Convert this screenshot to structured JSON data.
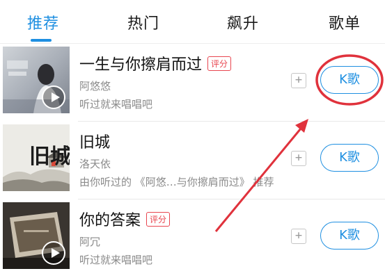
{
  "tabs": [
    {
      "label": "推荐",
      "active": true
    },
    {
      "label": "热门",
      "active": false
    },
    {
      "label": "飙升",
      "active": false
    },
    {
      "label": "歌单",
      "active": false
    }
  ],
  "songs": [
    {
      "title": "一生与你擦肩而过",
      "badge": "评分",
      "artist": "阿悠悠",
      "hint": "听过就来唱唱吧",
      "add_label": "+",
      "k_label": "K歌"
    },
    {
      "title": "旧城",
      "artist": "洛天依",
      "hint": "由你听过的 《阿悠…与你擦肩而过》 推荐",
      "add_label": "+",
      "k_label": "K歌",
      "cover_text": "旧城"
    },
    {
      "title": "你的答案",
      "badge": "评分",
      "artist": "阿冗",
      "hint": "听过就来唱唱吧",
      "add_label": "+",
      "k_label": "K歌"
    }
  ],
  "colors": {
    "accent": "#1e8fe1",
    "badge": "#e8454f",
    "annotation": "#e0323c"
  }
}
